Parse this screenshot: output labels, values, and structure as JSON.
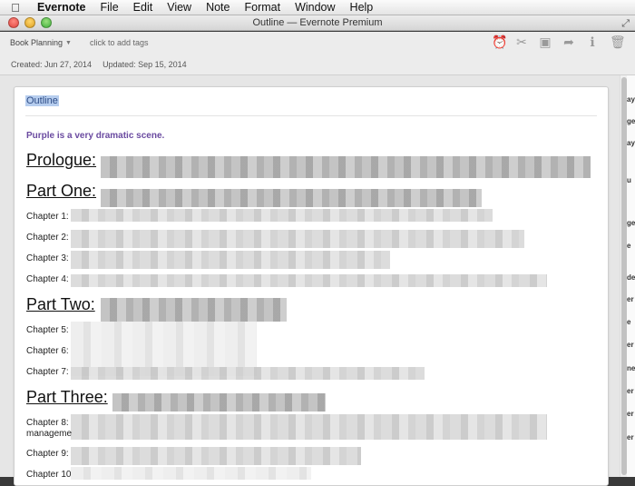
{
  "menubar": {
    "apple_icon": "",
    "app": "Evernote",
    "items": [
      "File",
      "Edit",
      "View",
      "Note",
      "Format",
      "Window",
      "Help"
    ]
  },
  "window": {
    "title": "Outline — Evernote Premium"
  },
  "toolbar": {
    "notebook": "Book Planning",
    "tags_placeholder": "click to add tags",
    "icons": [
      "reminder-icon",
      "share-icon",
      "presentation-icon",
      "forward-icon",
      "info-icon",
      "trash-icon"
    ],
    "icon_glyphs": [
      "⏰",
      "✂",
      "▣",
      "➦",
      "ℹ",
      "🗑"
    ]
  },
  "meta": {
    "created": "Created: Jun 27, 2014",
    "updated": "Updated: Sep 15, 2014"
  },
  "note": {
    "title": "Outline",
    "subhead": "Purple is a very dramatic scene.",
    "sections": [
      {
        "kind": "h2",
        "text": "Prologue:"
      },
      {
        "kind": "h2",
        "text": "Part One:"
      },
      {
        "kind": "ch",
        "text": "Chapter 1:"
      },
      {
        "kind": "ch",
        "text": "Chapter 2:"
      },
      {
        "kind": "ch",
        "text": "Chapter 3:"
      },
      {
        "kind": "ch",
        "text": "Chapter 4:"
      },
      {
        "kind": "h2",
        "text": "Part Two:"
      },
      {
        "kind": "ch",
        "text": "Chapter 5:"
      },
      {
        "kind": "ch",
        "text": "Chapter 6:"
      },
      {
        "kind": "ch",
        "text": "Chapter 7:"
      },
      {
        "kind": "h2",
        "text": "Part Three:"
      },
      {
        "kind": "ch",
        "text": "Chapter 8:"
      },
      {
        "kind": "ch",
        "text": "manageme"
      },
      {
        "kind": "ch",
        "text": "Chapter 9:"
      },
      {
        "kind": "ch",
        "text": "Chapter 10"
      }
    ]
  },
  "sidebar_peek": {
    "items": [
      "ay",
      "ge",
      "ay",
      "u",
      "ge",
      "e",
      "de",
      "er",
      "e",
      "er",
      "ne",
      "er",
      "er",
      "er"
    ]
  }
}
